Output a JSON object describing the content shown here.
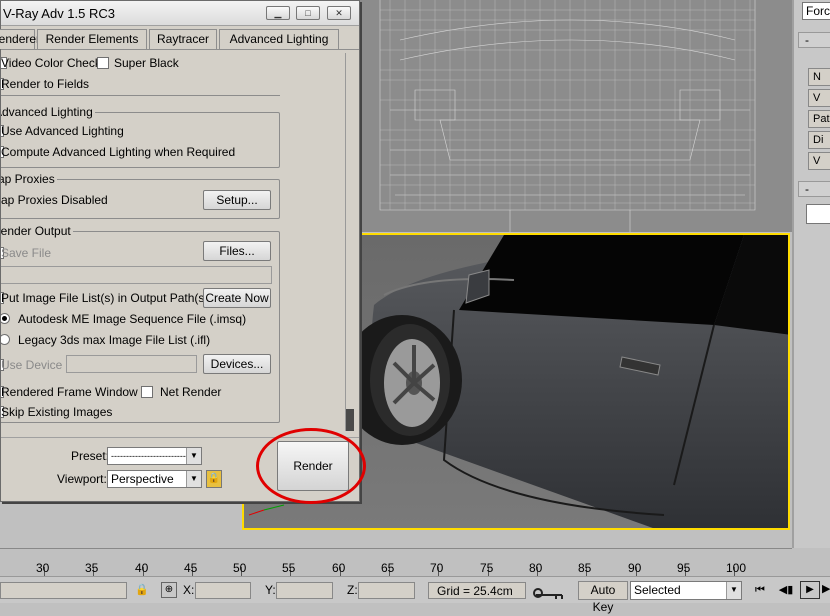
{
  "dialog": {
    "title": "V-Ray Adv 1.5 RC3",
    "tabs": [
      "Renderer",
      "Render Elements",
      "Raytracer",
      "Advanced Lighting"
    ]
  },
  "common": {
    "video_color_check": "Video Color Check",
    "super_black": "Super Black",
    "render_to_fields": "Render to Fields"
  },
  "advanced_lighting": {
    "title": "Advanced Lighting",
    "use": "Use Advanced Lighting",
    "compute": "Compute Advanced Lighting when Required"
  },
  "bitmap_proxies": {
    "title": "Bitmap Proxies",
    "status": "Bitmap Proxies Disabled",
    "setup": "Setup..."
  },
  "render_output": {
    "title": "Render Output",
    "save_file": "Save File",
    "files": "Files...",
    "put_image": "Put Image File List(s) in Output Path(s)",
    "create_now": "Create Now",
    "autodesk_me": "Autodesk ME Image Sequence File (.imsq)",
    "legacy": "Legacy 3ds max Image File List (.ifl)",
    "use_device": "Use Device",
    "devices": "Devices...",
    "rendered_frame_window": "Rendered Frame Window",
    "net_render": "Net Render",
    "skip_existing": "Skip Existing Images"
  },
  "bottom": {
    "preset_label": "Preset:",
    "preset_value": "--------------------------",
    "viewport_label": "Viewport:",
    "viewport_value": "Perspective",
    "render": "Render"
  },
  "timeline": {
    "ticks": [
      "30",
      "35",
      "40",
      "45",
      "50",
      "55",
      "60",
      "65",
      "70",
      "75",
      "80",
      "85",
      "90",
      "95",
      "100"
    ]
  },
  "status": {
    "x_label": "X:",
    "y_label": "Y:",
    "z_label": "Z:",
    "grid": "Grid = 25.4cm",
    "auto_key": "Auto Key",
    "selected": "Selected"
  },
  "command_panel": {
    "dropdown": "Force",
    "minus1": "-",
    "minus2": "-",
    "btn_labels": [
      "N",
      "V",
      "Pat",
      "Di",
      "V"
    ]
  },
  "colors": {
    "highlight_circle": "#e00000",
    "active_viewport_border": "#ffdc00"
  }
}
